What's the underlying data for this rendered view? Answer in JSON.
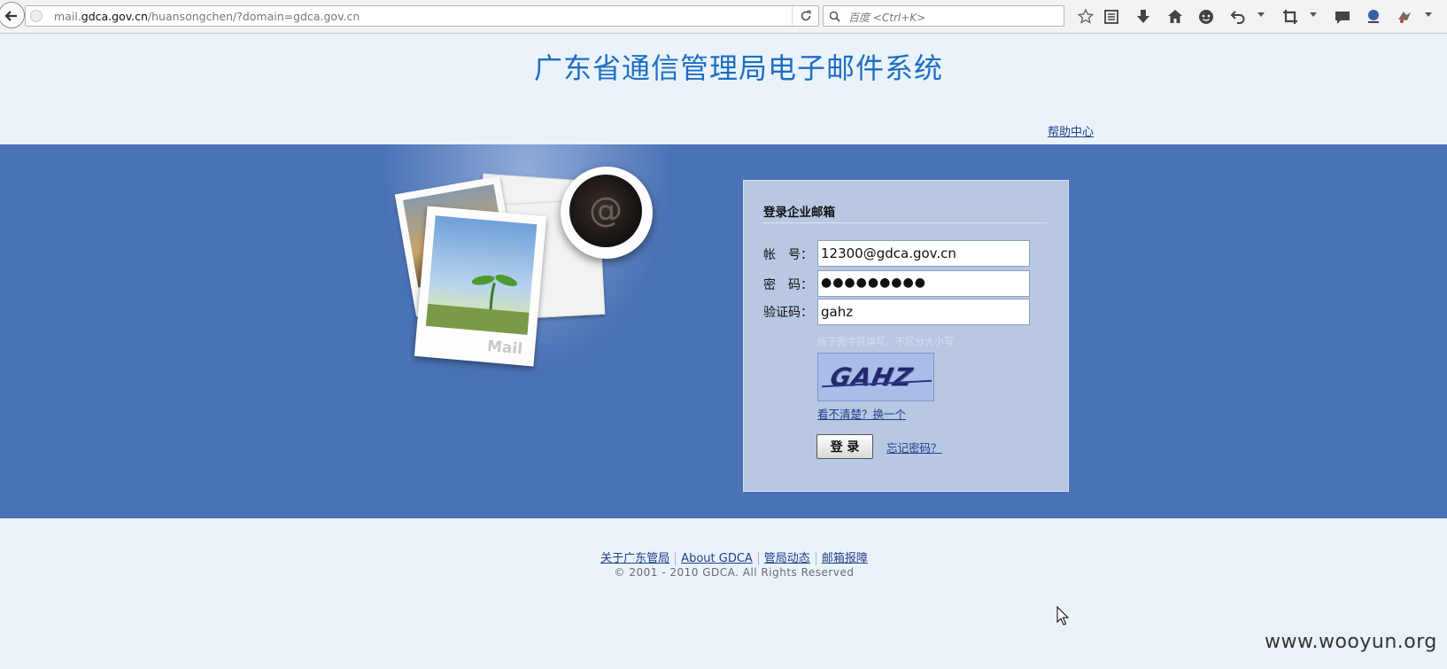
{
  "browser": {
    "url_host_prefix": "mail.",
    "url_host": "gdca.gov.cn",
    "url_path": "/huansongchen/?domain=gdca.gov.cn",
    "search_placeholder": "百度 <Ctrl+K>",
    "toolbar_icons": [
      "bookmark-star-icon",
      "reading-list-icon",
      "download-icon",
      "home-icon",
      "chat-icon",
      "undo-icon",
      "crop-icon",
      "comment-icon",
      "extension-icon",
      "addon-icon"
    ]
  },
  "header": {
    "title": "广东省通信管理局电子邮件系统",
    "help_link": "帮助中心"
  },
  "login": {
    "panel_title": "登录企业邮箱",
    "account_label": "帐　号：",
    "account_value": "12300@gdca.gov.cn",
    "password_label": "密　码：",
    "password_value": "●●●●●●●●●",
    "captcha_label": "验证码：",
    "captcha_value": "gahz",
    "captcha_hint": "按下图字符填写，不区分大小写",
    "captcha_image_text": "GAHZ",
    "refresh_link": "看不清楚？换一个",
    "login_button": "登 录",
    "forgot_link": "忘记密码？"
  },
  "illustration": {
    "mail_text": "Mail",
    "at_symbol": "@"
  },
  "footer": {
    "links": [
      "关于广东管局",
      "About GDCA",
      "管局动态",
      "邮箱报障"
    ],
    "copyright": "© 2001 - 2010 GDCA. All Rights Reserved"
  },
  "watermark": "www.wooyun.org",
  "colors": {
    "band": "#4a72b6",
    "title": "#1e6fc3",
    "panel": "#b8c8e2",
    "page_bg": "#eaf2fa"
  }
}
